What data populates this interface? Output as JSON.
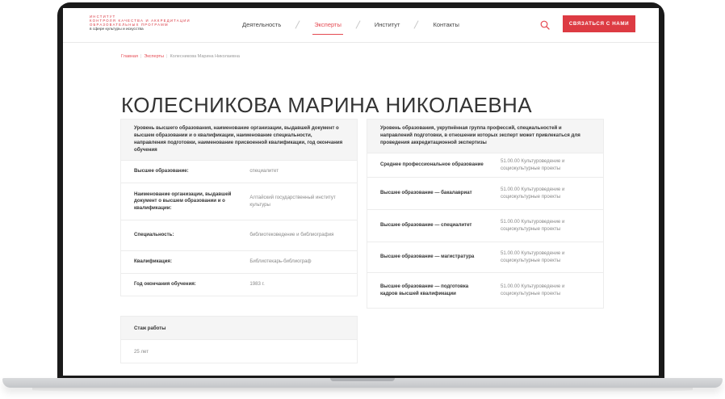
{
  "header": {
    "logo_line1": "ИНСТИТУТ",
    "logo_line2": "КОНТРОЛЯ КАЧЕСТВА И АККРЕДИТАЦИИ",
    "logo_line3": "ОБРАЗОВАТЕЛЬНЫХ ПРОГРАММ",
    "logo_line4": "в сфере культуры и искусства",
    "nav": [
      "Деятельность",
      "Эксперты",
      "Институт",
      "Контакты"
    ],
    "active_nav": "Эксперты",
    "cta_label": "СВЯЗАТЬСЯ С НАМИ",
    "search_icon": "search-icon"
  },
  "breadcrumb": {
    "home": "Главная",
    "section": "Эксперты",
    "current": "Колесникова Марина Николаевна"
  },
  "page_title": "КОЛЕСНИКОВА МАРИНА НИКОЛАЕВНА",
  "education": {
    "heading": "Уровень высшего образования, наименование организации, выдавшей документ о высшем образовании и о квалификации, наименование специальности, направления подготовки, наименование присвоенной квалификации, год окончания обучения",
    "rows": [
      {
        "key": "Высшее образование:",
        "value": "специалитет"
      },
      {
        "key": "Наименование организации, выдавшей документ о высшем образовании и о квалификации:",
        "value": "Алтайский государственный институт культуры"
      },
      {
        "key": "Специальность:",
        "value": "библиотековедение и библиография"
      },
      {
        "key": "Квалификация:",
        "value": "Библиотекарь-библиограф"
      },
      {
        "key": "Год окончания обучения:",
        "value": "1983 г."
      }
    ]
  },
  "experience": {
    "heading": "Стаж работы",
    "value": "25 лет"
  },
  "accreditation": {
    "heading": "Уровень образования, укрупнённая группа профессий, специальностей и направлений подготовки, в отношении которых эксперт может привлекаться для проведения аккредитационной экспертизы",
    "rows": [
      {
        "key": "Среднее профессиональное образование",
        "value": "51.00.00 Культуроведение и социокультурные проекты"
      },
      {
        "key": "Высшее образование — бакалавриат",
        "value": "51.00.00 Культуроведение и социокультурные проекты"
      },
      {
        "key": "Высшее образование — специалитет",
        "value": "51.00.00 Культуроведение и социокультурные проекты"
      },
      {
        "key": "Высшее образование — магистратура",
        "value": "51.00.00 Культуроведение и социокультурные проекты"
      },
      {
        "key": "Высшее образование — подготовка кадров высшей квалификации",
        "value": "51.00.00 Культуроведение и социокультурные проекты"
      }
    ]
  },
  "colors": {
    "accent": "#dd3b43",
    "text": "#333333",
    "muted": "#888888",
    "panel": "#f5f5f5"
  }
}
